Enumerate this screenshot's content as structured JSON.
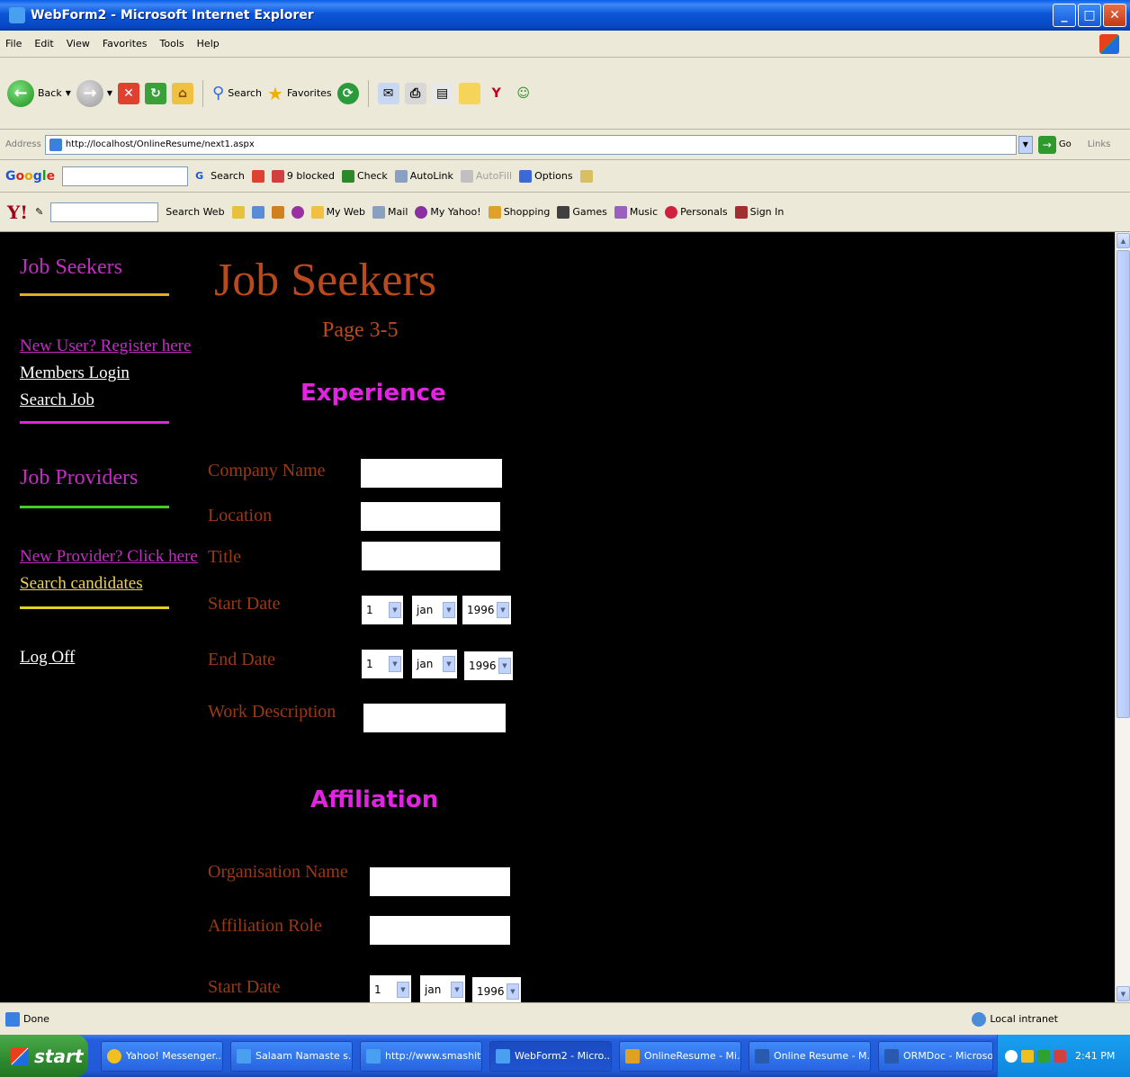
{
  "window": {
    "title": "WebForm2 - Microsoft Internet Explorer"
  },
  "menu": [
    "File",
    "Edit",
    "View",
    "Favorites",
    "Tools",
    "Help"
  ],
  "toolbar": {
    "back": "Back",
    "search": "Search",
    "favorites": "Favorites"
  },
  "address": {
    "label": "Address",
    "url": "http://localhost/OnlineResume/next1.aspx",
    "go": "Go",
    "links": "Links"
  },
  "google": {
    "search": "Search",
    "blocked": "9 blocked",
    "check": "Check",
    "autolink": "AutoLink",
    "autofill": "AutoFill",
    "options": "Options"
  },
  "yahoo": {
    "search_web": "Search Web",
    "my_web": "My Web",
    "mail": "Mail",
    "my_yahoo": "My Yahoo!",
    "shopping": "Shopping",
    "games": "Games",
    "music": "Music",
    "personals": "Personals",
    "sign_in": "Sign In"
  },
  "sidebar": {
    "seekers_heading": "Job Seekers",
    "new_user": "New User? Register here",
    "members_login": "Members Login",
    "search_job": "Search Job",
    "providers_heading": "Job Providers",
    "new_provider": "New Provider? Click here",
    "search_candidates": "Search candidates",
    "log_off": "Log Off"
  },
  "main": {
    "title": "Job Seekers",
    "subtitle": "Page 3-5",
    "experience": {
      "heading": "Experience",
      "company_label": "Company Name",
      "location_label": "Location",
      "title_label": "Title",
      "start_label": "Start Date",
      "end_label": "End Date",
      "desc_label": "Work Description",
      "start": {
        "day": "1",
        "month": "jan",
        "year": "1996"
      },
      "end": {
        "day": "1",
        "month": "jan",
        "year": "1996"
      }
    },
    "affiliation": {
      "heading": "Affiliation",
      "org_label": "Organisation Name",
      "role_label": "Affiliation Role",
      "start_label": "Start Date",
      "start": {
        "day": "1",
        "month": "jan",
        "year": "1996"
      }
    }
  },
  "status": {
    "text": "Done",
    "zone": "Local intranet"
  },
  "taskbar": {
    "start": "start",
    "items": [
      "Yahoo! Messenger...",
      "Salaam Namaste s...",
      "http://www.smashit...",
      "WebForm2 - Micro...",
      "OnlineResume - Mi...",
      "Online Resume - M...",
      "ORMDoc - Microsof..."
    ],
    "clock": "2:41 PM"
  },
  "colors": {
    "seeker_pink": "#c42cc4",
    "label_brown": "#9a3a12",
    "heading_magenta": "#e024e0",
    "title_orange": "#b84a1e"
  }
}
